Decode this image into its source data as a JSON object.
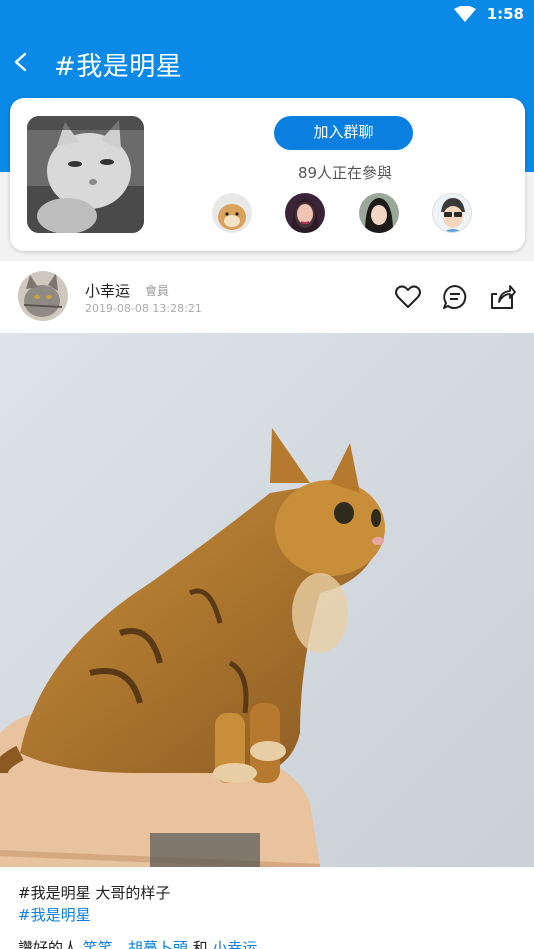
{
  "status_bar": {
    "time": "1:58",
    "wifi": "wifi-icon"
  },
  "app_bar": {
    "title": "#我是明星",
    "back_icon": "chevron-left-icon"
  },
  "group_card": {
    "join_label": "加入群聊",
    "participants_text": "89人正在參與"
  },
  "post": {
    "author_name": "小幸运",
    "author_badge": "會員",
    "timestamp": "2019-08-08 13:28:21",
    "caption": "#我是明星 大哥的样子",
    "hashtag": "#我是明星",
    "likes_prefix": "讚好的人",
    "liker_1": "笑笑",
    "separator": "、",
    "liker_2": "胡蔓卜頭",
    "conjunction": "和",
    "liker_3": "小幸运"
  },
  "colors": {
    "primary": "#0a8ae6",
    "accent": "#0a7fe0"
  }
}
